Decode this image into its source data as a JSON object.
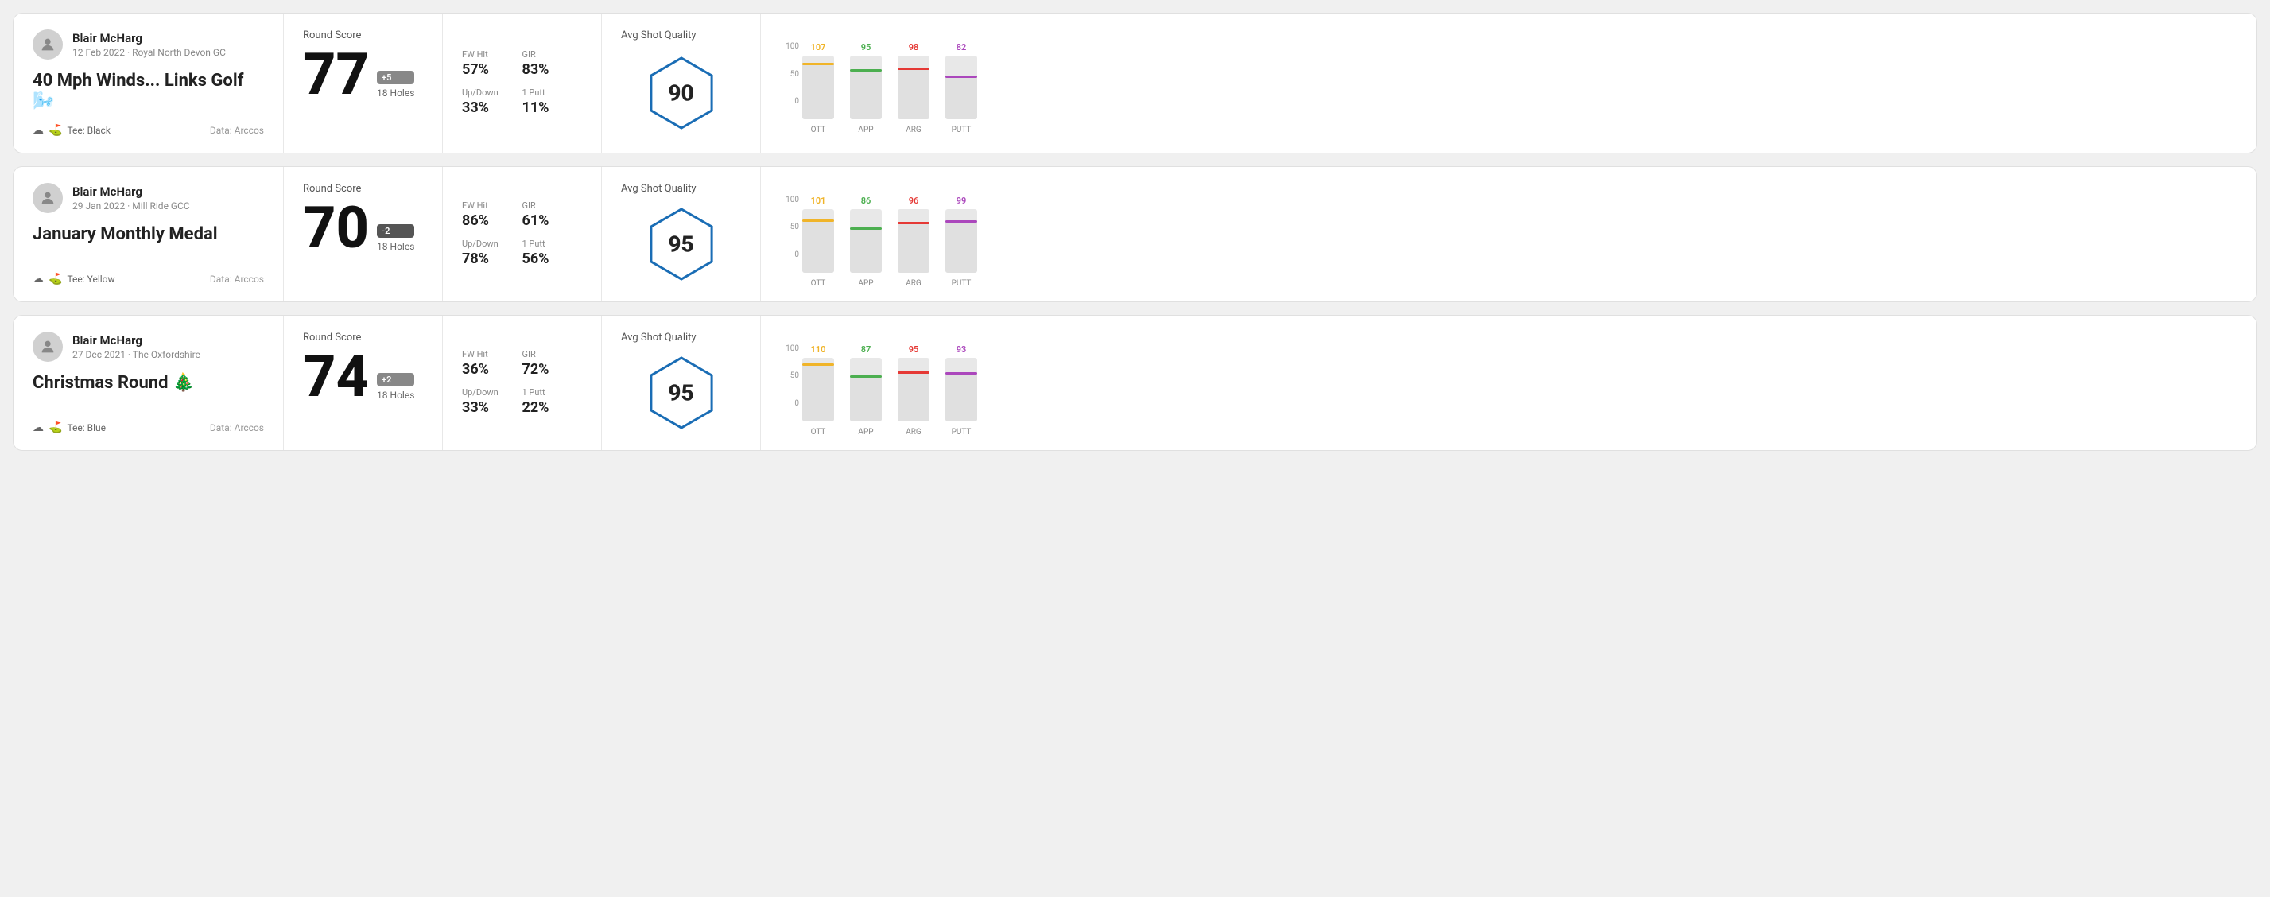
{
  "rounds": [
    {
      "id": "round1",
      "player": "Blair McHarg",
      "date": "12 Feb 2022 · Royal North Devon GC",
      "title": "40 Mph Winds... Links Golf 🌬️",
      "tee": "Tee: Black",
      "data_source": "Data: Arccos",
      "score": "77",
      "score_diff": "+5",
      "score_diff_type": "positive",
      "holes": "18 Holes",
      "fw_hit": "57%",
      "gir": "83%",
      "up_down": "33%",
      "one_putt": "11%",
      "avg_quality": "90",
      "chart": {
        "bars": [
          {
            "label": "OTT",
            "value": 107,
            "color": "#f0b429",
            "max": 120
          },
          {
            "label": "APP",
            "value": 95,
            "color": "#4caf50",
            "max": 120
          },
          {
            "label": "ARG",
            "value": 98,
            "color": "#e53935",
            "max": 120
          },
          {
            "label": "PUTT",
            "value": 82,
            "color": "#ab47bc",
            "max": 120
          }
        ]
      }
    },
    {
      "id": "round2",
      "player": "Blair McHarg",
      "date": "29 Jan 2022 · Mill Ride GCC",
      "title": "January Monthly Medal",
      "tee": "Tee: Yellow",
      "data_source": "Data: Arccos",
      "score": "70",
      "score_diff": "-2",
      "score_diff_type": "negative",
      "holes": "18 Holes",
      "fw_hit": "86%",
      "gir": "61%",
      "up_down": "78%",
      "one_putt": "56%",
      "avg_quality": "95",
      "chart": {
        "bars": [
          {
            "label": "OTT",
            "value": 101,
            "color": "#f0b429",
            "max": 120
          },
          {
            "label": "APP",
            "value": 86,
            "color": "#4caf50",
            "max": 120
          },
          {
            "label": "ARG",
            "value": 96,
            "color": "#e53935",
            "max": 120
          },
          {
            "label": "PUTT",
            "value": 99,
            "color": "#ab47bc",
            "max": 120
          }
        ]
      }
    },
    {
      "id": "round3",
      "player": "Blair McHarg",
      "date": "27 Dec 2021 · The Oxfordshire",
      "title": "Christmas Round 🎄",
      "tee": "Tee: Blue",
      "data_source": "Data: Arccos",
      "score": "74",
      "score_diff": "+2",
      "score_diff_type": "positive",
      "holes": "18 Holes",
      "fw_hit": "36%",
      "gir": "72%",
      "up_down": "33%",
      "one_putt": "22%",
      "avg_quality": "95",
      "chart": {
        "bars": [
          {
            "label": "OTT",
            "value": 110,
            "color": "#f0b429",
            "max": 120
          },
          {
            "label": "APP",
            "value": 87,
            "color": "#4caf50",
            "max": 120
          },
          {
            "label": "ARG",
            "value": 95,
            "color": "#e53935",
            "max": 120
          },
          {
            "label": "PUTT",
            "value": 93,
            "color": "#ab47bc",
            "max": 120
          }
        ]
      }
    }
  ],
  "labels": {
    "round_score": "Round Score",
    "fw_hit": "FW Hit",
    "gir": "GIR",
    "up_down": "Up/Down",
    "one_putt": "1 Putt",
    "avg_shot_quality": "Avg Shot Quality",
    "data_arccos": "Data: Arccos"
  }
}
